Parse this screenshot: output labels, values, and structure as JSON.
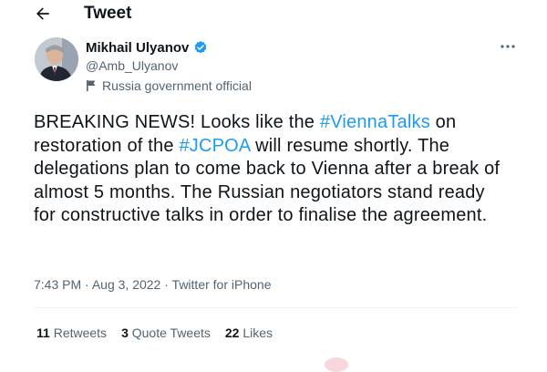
{
  "header": {
    "title": "Tweet",
    "back_icon": "arrow-left-icon"
  },
  "author": {
    "name": "Mikhail Ulyanov",
    "handle": "@Amb_Ulyanov",
    "verified_icon": "verified-badge-icon",
    "label_icon": "flag-icon",
    "label": "Russia government official"
  },
  "tweet": {
    "segments": [
      {
        "text": "BREAKING NEWS! Looks like the ",
        "hashtag": false
      },
      {
        "text": "#ViennaTalks",
        "hashtag": true
      },
      {
        "text": " on restoration of the ",
        "hashtag": false
      },
      {
        "text": "#JCPOA",
        "hashtag": true
      },
      {
        "text": " will resume shortly. The delegations plan to come back to Vienna after a break of almost 5 months. The Russian negotiators stand ready for constructive talks in order to finalise the agreement.",
        "hashtag": false
      }
    ]
  },
  "meta": {
    "time": "7:43 PM",
    "date": "Aug 3, 2022",
    "source": "Twitter for iPhone",
    "separator": "·"
  },
  "stats": {
    "retweets_count": "11",
    "retweets_label": "Retweets",
    "quote_count": "3",
    "quote_label": "Quote Tweets",
    "likes_count": "22",
    "likes_label": "Likes"
  },
  "colors": {
    "link": "#1d9bf0",
    "secondary_text": "#536471",
    "primary_text": "#0f1419"
  }
}
